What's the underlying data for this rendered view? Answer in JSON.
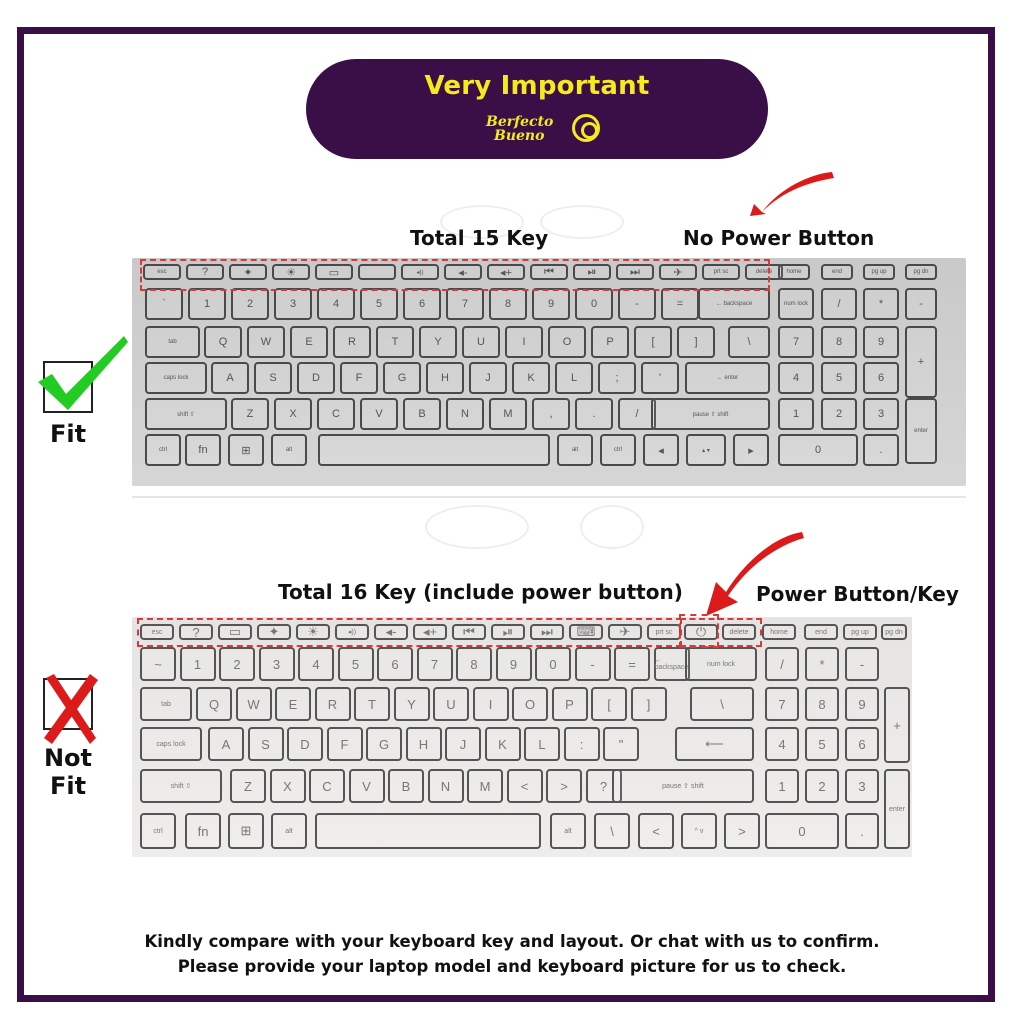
{
  "banner": {
    "title": "Very Important",
    "brand_line1": "Berfecto",
    "brand_line2": "Bueno"
  },
  "colors": {
    "frame": "#3a0f47",
    "banner_text": "#f5ea1c",
    "highlight_dash": "#d63a3a",
    "check": "#22cc22",
    "cross": "#dd1a1a"
  },
  "fit_section": {
    "status_label": "Fit",
    "status_icon": "check-mark-icon",
    "heading_left": "Total 15 Key",
    "heading_right": "No Power Button",
    "keyboard": {
      "row_fn": [
        "esc",
        "?",
        "✦",
        "☀",
        "▭",
        "",
        "◂))",
        "◂-",
        "◂+",
        "⏮",
        "⏯",
        "⏭",
        "✈",
        "prt sc",
        "delete",
        "home",
        "end",
        "pg up",
        "pg dn"
      ],
      "row_num": [
        "`",
        "1",
        "2",
        "3",
        "4",
        "5",
        "6",
        "7",
        "8",
        "9",
        "0",
        "-",
        "=",
        "← backspace",
        "num lock",
        "/",
        "*",
        "-"
      ],
      "row_q": [
        "tab",
        "Q",
        "W",
        "E",
        "R",
        "T",
        "Y",
        "U",
        "I",
        "O",
        "P",
        "[",
        "]",
        "\\",
        "7",
        "8",
        "9",
        "+"
      ],
      "row_a": [
        "caps lock",
        "A",
        "S",
        "D",
        "F",
        "G",
        "H",
        "J",
        "K",
        "L",
        ";",
        "'",
        "← enter",
        "4",
        "5",
        "6"
      ],
      "row_z": [
        "shift ⇧",
        "Z",
        "X",
        "C",
        "V",
        "B",
        "N",
        "M",
        ",",
        ".",
        "/",
        "pause ⇧ shift",
        "1",
        "2",
        "3",
        "enter"
      ],
      "row_bottom": [
        "ctrl",
        "fn",
        "⊞",
        "alt",
        "",
        "alt",
        "ctrl",
        "◂",
        "▴ ▾",
        "▸",
        "0",
        "."
      ]
    }
  },
  "notfit_section": {
    "status_label_line1": "Not",
    "status_label_line2": "Fit",
    "status_icon": "cross-mark-icon",
    "heading_left": "Total 16 Key (include power button)",
    "heading_right": "Power Button/Key",
    "keyboard": {
      "row_fn": [
        "esc",
        "?",
        "▭",
        "✦",
        "☀",
        "◂))",
        "◂-",
        "◂+",
        "⏮",
        "⏯",
        "⏭",
        "⌨",
        "✈",
        "prt sc",
        "⏻",
        "delete",
        "home",
        "end",
        "pg up",
        "pg dn"
      ],
      "row_num": [
        "~",
        "1",
        "2",
        "3",
        "4",
        "5",
        "6",
        "7",
        "8",
        "9",
        "0",
        "-",
        "=",
        "← backspace",
        "num lock",
        "/",
        "*",
        "-"
      ],
      "row_q": [
        "tab",
        "Q",
        "W",
        "E",
        "R",
        "T",
        "Y",
        "U",
        "I",
        "O",
        "P",
        "[",
        "]",
        "\\",
        "7",
        "8",
        "9",
        "+"
      ],
      "row_a": [
        "caps lock",
        "A",
        "S",
        "D",
        "F",
        "G",
        "H",
        "J",
        "K",
        "L",
        ":",
        "\"",
        "⟵",
        "4",
        "5",
        "6"
      ],
      "row_z": [
        "shift ⇧",
        "Z",
        "X",
        "C",
        "V",
        "B",
        "N",
        "M",
        "<",
        ">",
        "?",
        "pause ⇧ shift",
        "1",
        "2",
        "3",
        "enter"
      ],
      "row_bottom": [
        "ctrl",
        "fn",
        "⊞",
        "alt",
        "",
        "alt",
        "\\",
        "<",
        "^ v",
        ">",
        "0",
        "."
      ]
    }
  },
  "footer": {
    "line1": "Kindly compare with your keyboard key and layout. Or chat with us to confirm.",
    "line2": "Please provide your laptop model and keyboard picture for us to check."
  }
}
